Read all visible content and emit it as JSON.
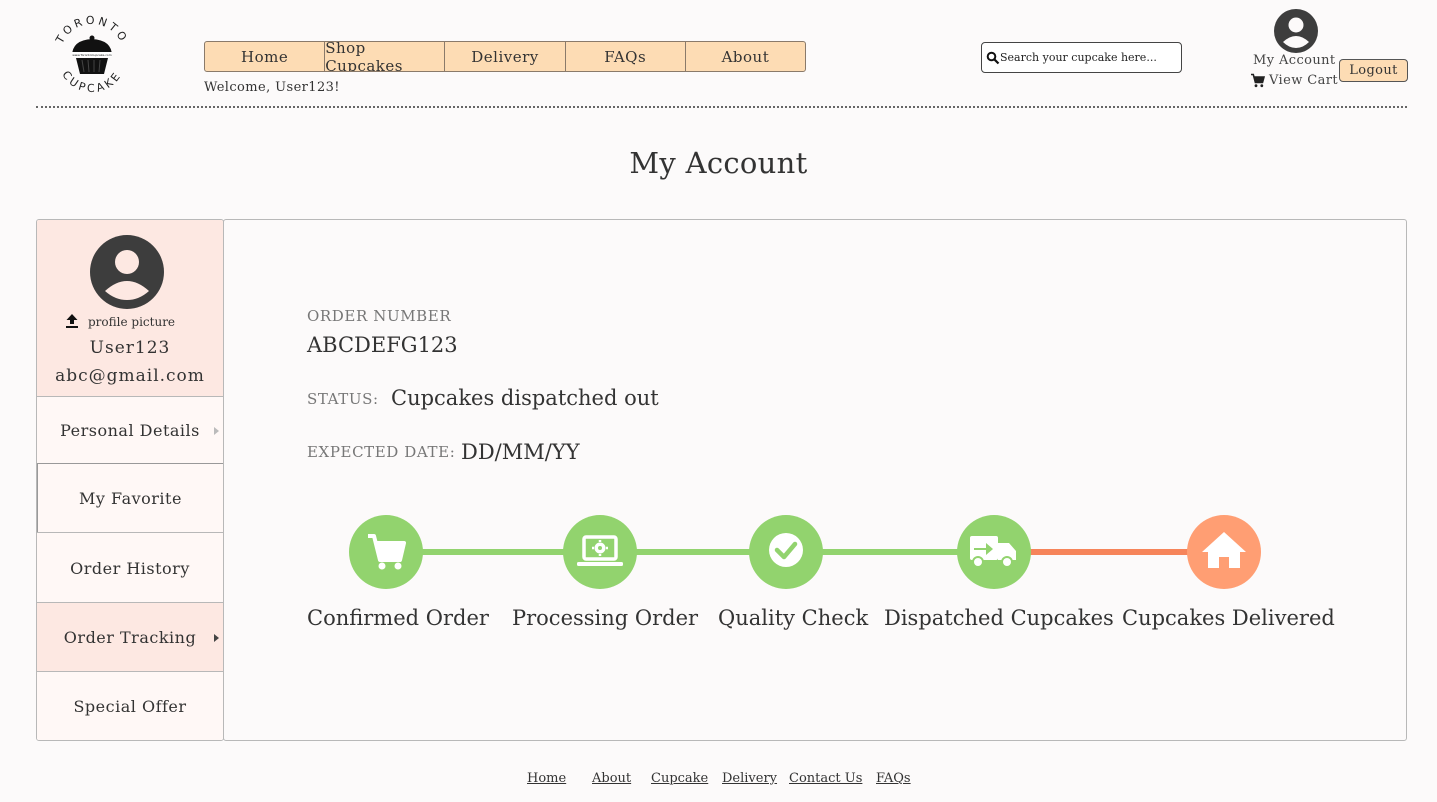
{
  "logo": {
    "top_text": "TORONTO",
    "bottom_text": "CUPCAKE",
    "inner_text": "www.TorontoCupcake.com"
  },
  "nav": {
    "items": [
      "Home",
      "Shop Cupcakes",
      "Delivery",
      "FAQs",
      "About"
    ]
  },
  "welcome": "Welcome, User123!",
  "search": {
    "placeholder": "Search your cupcake here..."
  },
  "account": {
    "my_account": "My Account",
    "view_cart": "View Cart",
    "logout": "Logout"
  },
  "page_title": "My Account",
  "sidebar": {
    "upload_label": "profile picture",
    "username": "User123",
    "email": "abc@gmail.com",
    "items": [
      {
        "label": "Personal Details",
        "arrow": true,
        "active": false
      },
      {
        "label": "My Favorite",
        "arrow": false,
        "active": false
      },
      {
        "label": "Order History",
        "arrow": false,
        "active": false
      },
      {
        "label": "Order Tracking",
        "arrow": true,
        "active": true
      },
      {
        "label": "Special Offer",
        "arrow": false,
        "active": false
      }
    ]
  },
  "order": {
    "number_label": "ORDER NUMBER",
    "number": "ABCDEFG123",
    "status_label": "STATUS:",
    "status": "Cupcakes dispatched out",
    "date_label": "EXPECTED DATE:",
    "date": "DD/MM/YY"
  },
  "tracking": {
    "steps": [
      {
        "label": "Confirmed Order",
        "icon": "cart-icon",
        "done": true
      },
      {
        "label": "Processing Order",
        "icon": "laptop-gear-icon",
        "done": true
      },
      {
        "label": "Quality Check",
        "icon": "check-icon",
        "done": true
      },
      {
        "label": "Dispatched Cupcakes",
        "icon": "truck-icon",
        "done": true
      },
      {
        "label": "Cupcakes Delivered",
        "icon": "home-icon",
        "done": false
      }
    ],
    "colors": {
      "done": "#92d36e",
      "pending": "#ff9e73",
      "pending_line": "#f6845a"
    }
  },
  "footer": {
    "links": [
      "Home",
      "About",
      "Cupcake",
      "Delivery",
      "Contact Us",
      "FAQs"
    ]
  }
}
